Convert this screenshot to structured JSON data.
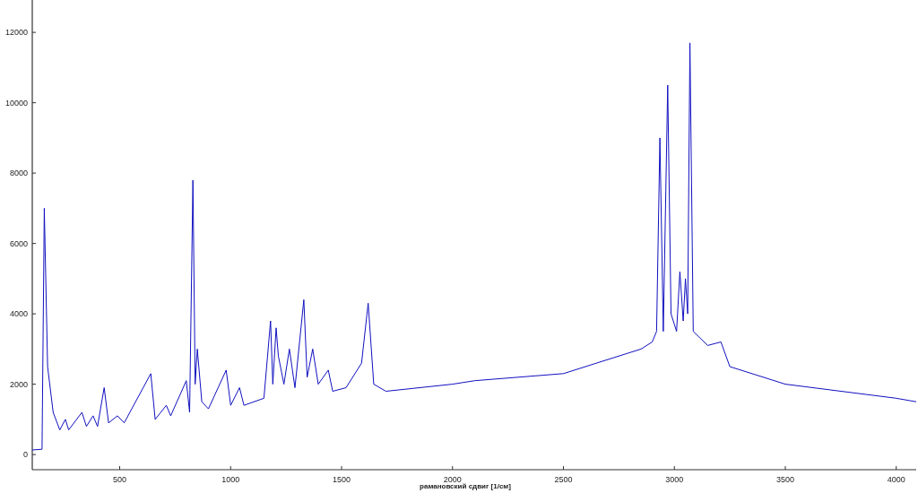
{
  "chart": {
    "chart_data": {
      "type": "line",
      "xlabel": "рамановский сдвиг [1/см]",
      "xlim": [
        106,
        4090
      ],
      "ylim": [
        -430,
        12920
      ],
      "xticks": [
        500,
        1000,
        1500,
        2000,
        2500,
        3000,
        3500,
        4000
      ],
      "yticks": [
        0,
        2000,
        4000,
        6000,
        8000,
        10000,
        12000
      ],
      "x": [
        106,
        150,
        160,
        175,
        200,
        230,
        255,
        270,
        330,
        350,
        380,
        400,
        430,
        450,
        490,
        520,
        640,
        660,
        710,
        730,
        800,
        815,
        830,
        840,
        850,
        870,
        900,
        980,
        1000,
        1040,
        1060,
        1150,
        1180,
        1190,
        1205,
        1215,
        1240,
        1265,
        1290,
        1330,
        1345,
        1370,
        1395,
        1440,
        1460,
        1520,
        1590,
        1620,
        1645,
        1700,
        2000,
        2100,
        2500,
        2700,
        2850,
        2900,
        2920,
        2935,
        2950,
        2970,
        2985,
        3010,
        3025,
        3040,
        3050,
        3060,
        3070,
        3085,
        3150,
        3210,
        3250,
        3500,
        4000,
        4090
      ],
      "series": [
        {
          "color": "#1010c0",
          "values": [
            130,
            150,
            7000,
            2500,
            1200,
            700,
            1000,
            700,
            1200,
            800,
            1100,
            800,
            1900,
            900,
            1100,
            900,
            2300,
            1000,
            1400,
            1100,
            2100,
            1200,
            7800,
            2000,
            3000,
            1500,
            1300,
            2400,
            1400,
            1900,
            1400,
            1600,
            3800,
            2000,
            3600,
            2800,
            2000,
            3000,
            1900,
            4400,
            2200,
            3000,
            2000,
            2400,
            1800,
            1900,
            2600,
            4300,
            2000,
            1800,
            2000,
            2100,
            2300,
            2700,
            3000,
            3200,
            3500,
            9000,
            3500,
            10500,
            4000,
            3500,
            5200,
            3800,
            5000,
            4000,
            11700,
            3500,
            3100,
            3200,
            2500,
            2000,
            1600,
            1500
          ]
        }
      ]
    }
  }
}
